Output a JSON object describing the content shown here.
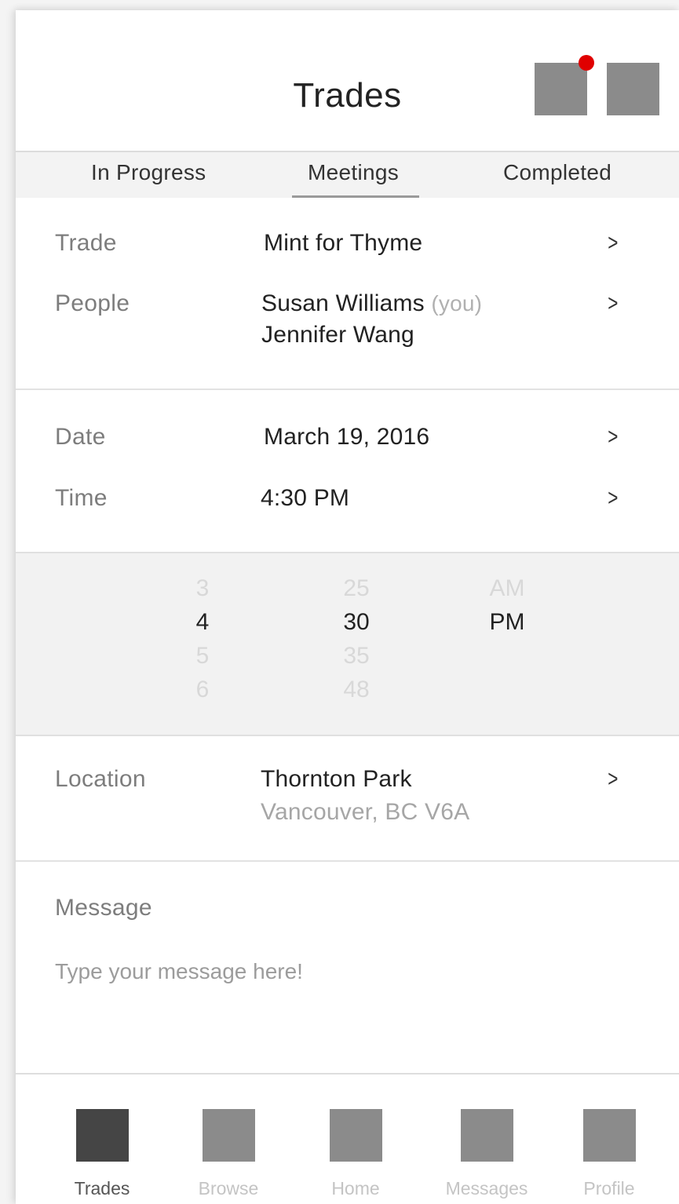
{
  "header": {
    "title": "Trades",
    "notification_dot_color": "#e00000"
  },
  "tabs": [
    {
      "label": "In Progress",
      "active": false
    },
    {
      "label": "Meetings",
      "active": true
    },
    {
      "label": "Completed",
      "active": false
    }
  ],
  "details": {
    "trade": {
      "label": "Trade",
      "value": "Mint for Thyme"
    },
    "people": {
      "label": "People",
      "name1": "Susan Williams",
      "you_tag": "(you)",
      "name2": "Jennifer Wang"
    },
    "date": {
      "label": "Date",
      "value": "March 19, 2016"
    },
    "time": {
      "label": "Time",
      "value": "4:30 PM"
    }
  },
  "time_picker": {
    "hours": [
      "3",
      "4",
      "5",
      "6"
    ],
    "minutes": [
      "25",
      "30",
      "35",
      "48"
    ],
    "periods": [
      "AM",
      "PM"
    ],
    "selected": {
      "hour": "4",
      "minute": "30",
      "period": "PM"
    }
  },
  "location": {
    "label": "Location",
    "name": "Thornton Park",
    "address": "Vancouver, BC V6A"
  },
  "message": {
    "label": "Message",
    "placeholder": "Type your message here!",
    "value": ""
  },
  "bottom_nav": [
    {
      "label": "Trades",
      "active": true
    },
    {
      "label": "Browse",
      "active": false
    },
    {
      "label": "Home",
      "active": false
    },
    {
      "label": "Messages",
      "active": false
    },
    {
      "label": "Profile",
      "active": false
    }
  ],
  "icons": {
    "chevron": "chevron-right-icon",
    "header_left": "notifications-icon",
    "header_right": "menu-icon"
  },
  "colors": {
    "active_nav_icon": "#454545",
    "inactive_icon": "#8b8b8b"
  }
}
